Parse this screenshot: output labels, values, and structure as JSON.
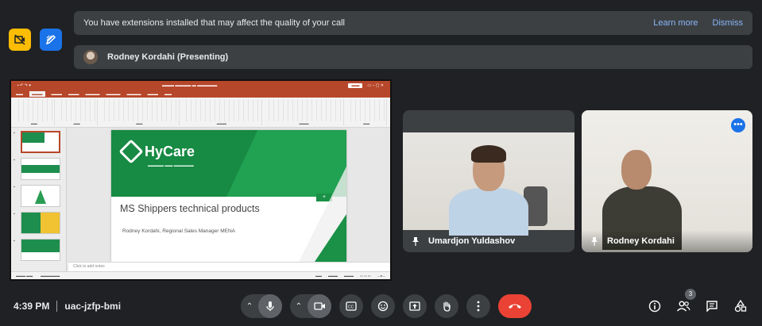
{
  "banner": {
    "message": "You have extensions installed that may affect the quality of your call",
    "learn_more": "Learn more",
    "dismiss": "Dismiss"
  },
  "presenting": {
    "label": "Rodney Kordahi (Presenting)"
  },
  "shared_screen": {
    "slide": {
      "brand": "HyCare",
      "heading": "MS Shippers technical products",
      "author": "Rodney Kordahi, Regional Sales Manager MENA"
    },
    "notes_placeholder": "Click to add notes"
  },
  "participants": [
    {
      "name": "Umardjon Yuldashov"
    },
    {
      "name": "Rodney Kordahi"
    }
  ],
  "meeting": {
    "time": "4:39 PM",
    "code": "uac-jzfp-bmi",
    "people_count": "3"
  },
  "colors": {
    "background": "#202124",
    "accent_blue": "#1a73e8",
    "end_call_red": "#ea4335"
  }
}
